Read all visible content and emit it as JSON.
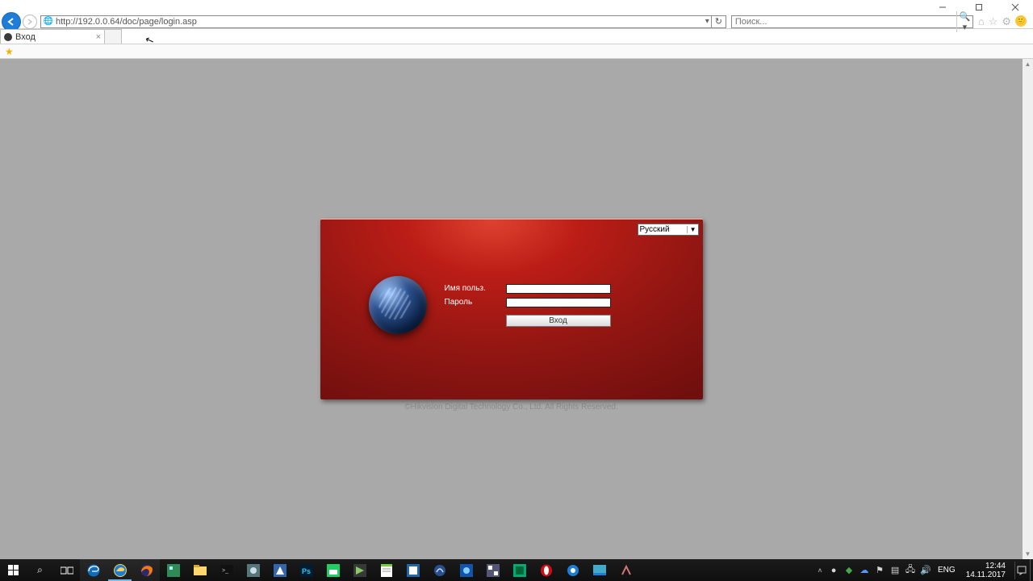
{
  "window": {
    "url": "http://192.0.0.64/doc/page/login.asp",
    "search_placeholder": "Поиск...",
    "tab_title": "Вход"
  },
  "login": {
    "language": "Русский",
    "username_label": "Имя польз.",
    "password_label": "Пароль",
    "username_value": "",
    "password_value": "",
    "button": "Вход",
    "copyright": "©Hikvision Digital Technology Co., Ltd. All Rights Reserved."
  },
  "systray": {
    "lang": "ENG",
    "time": "12:44",
    "date": "14.11.2017"
  }
}
